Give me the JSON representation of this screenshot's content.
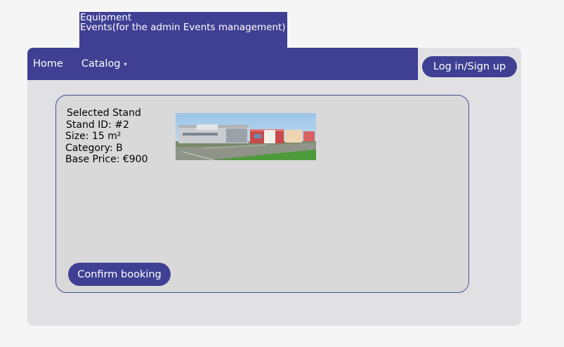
{
  "header": {
    "title_line1": "Equipment",
    "title_line2": "Events(for the admin Events management)"
  },
  "nav": {
    "home": "Home",
    "catalog": "Catalog",
    "catalog_caret": "▾",
    "login": "Log in/Sign up"
  },
  "stand": {
    "heading": "Selected Stand",
    "id": "Stand ID: #2",
    "size": "Size: 15 m²",
    "category": "Category: B",
    "base_price": "Base Price: €900"
  },
  "actions": {
    "confirm": "Confirm booking"
  },
  "colors": {
    "primary": "#3f3f93",
    "frame_bg": "#e1e1e4",
    "card_bg": "#d9d9d9",
    "page_bg": "#f5f5f5"
  }
}
